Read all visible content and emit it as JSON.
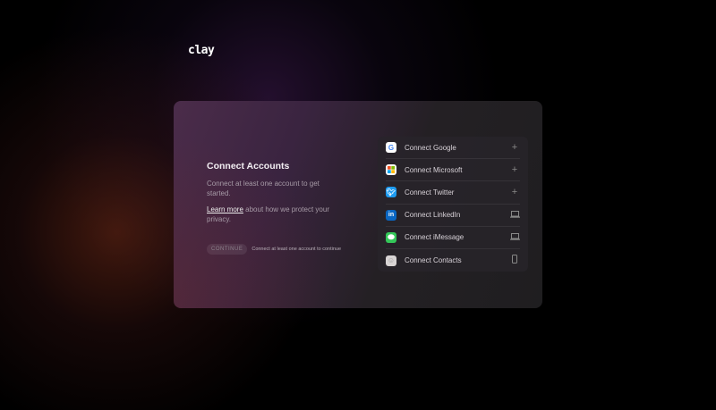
{
  "logo": "clay",
  "card": {
    "title": "Connect Accounts",
    "subtitle": "Connect at least one account to get started.",
    "learn_more": "Learn more",
    "privacy_text": " about how we protect your privacy.",
    "continue_label": "CONTINUE",
    "continue_hint": "Connect at least one account to continue"
  },
  "accounts": [
    {
      "label": "Connect Google",
      "icon": "google-icon",
      "action": "plus-icon"
    },
    {
      "label": "Connect Microsoft",
      "icon": "microsoft-icon",
      "action": "plus-icon"
    },
    {
      "label": "Connect Twitter",
      "icon": "twitter-icon",
      "action": "plus-icon"
    },
    {
      "label": "Connect LinkedIn",
      "icon": "linkedin-icon",
      "action": "laptop-icon"
    },
    {
      "label": "Connect iMessage",
      "icon": "imessage-icon",
      "action": "laptop-icon"
    },
    {
      "label": "Connect Contacts",
      "icon": "contacts-icon",
      "action": "phone-icon"
    }
  ]
}
